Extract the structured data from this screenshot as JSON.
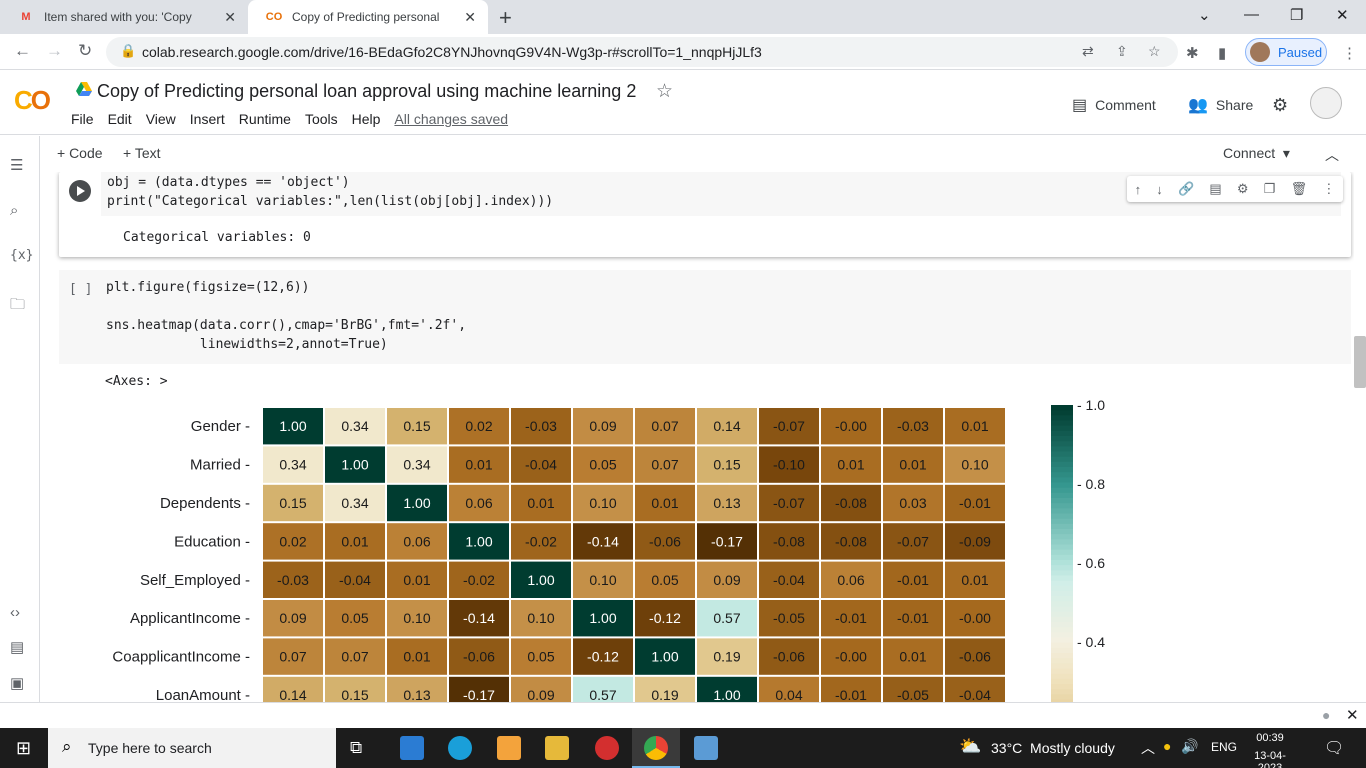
{
  "browser": {
    "tabs": [
      {
        "title": "Item shared with you: 'Copy of Pr",
        "icon": "gmail-icon"
      },
      {
        "title": "Copy of Predicting personal loan",
        "icon": "colab-icon"
      }
    ],
    "url": "colab.research.google.com/drive/16-BEdaGfo2C8YNJhovnqG9V4N-Wg3p-r#scrollTo=1_nnqpHjJLf3",
    "profile_status": "Paused"
  },
  "colab": {
    "logo": "CO",
    "title": "Copy of Predicting personal loan approval using machine learning 2",
    "menu": [
      "File",
      "Edit",
      "View",
      "Insert",
      "Runtime",
      "Tools",
      "Help"
    ],
    "saved_status": "All changes saved",
    "comment_label": "Comment",
    "share_label": "Share",
    "add_code": "+ Code",
    "add_text": "+ Text",
    "connect_label": "Connect"
  },
  "cells": {
    "cell1": {
      "line1": "obj = (data.dtypes == 'object')",
      "line2": "print(\"Categorical variables:\",len(list(obj[obj].index)))",
      "output": "Categorical variables: 0"
    },
    "cell2": {
      "bracket": "[ ]",
      "line1": "plt.figure(figsize=(12,6))",
      "line2": "sns.heatmap(data.corr(),cmap='BrBG',fmt='.2f',",
      "line3": "            linewidths=2,annot=True)",
      "output": "<Axes: >"
    }
  },
  "chart_data": {
    "type": "heatmap",
    "cmap": "BrBG",
    "rows": [
      "Gender",
      "Married",
      "Dependents",
      "Education",
      "Self_Employed",
      "ApplicantIncome",
      "CoapplicantIncome",
      "LoanAmount"
    ],
    "values": [
      [
        "1.00",
        "0.34",
        "0.15",
        "0.02",
        "-0.03",
        "0.09",
        "0.07",
        "0.14",
        "-0.07",
        "-0.00",
        "-0.03",
        "0.01"
      ],
      [
        "0.34",
        "1.00",
        "0.34",
        "0.01",
        "-0.04",
        "0.05",
        "0.07",
        "0.15",
        "-0.10",
        "0.01",
        "0.01",
        "0.10"
      ],
      [
        "0.15",
        "0.34",
        "1.00",
        "0.06",
        "0.01",
        "0.10",
        "0.01",
        "0.13",
        "-0.07",
        "-0.08",
        "0.03",
        "-0.01"
      ],
      [
        "0.02",
        "0.01",
        "0.06",
        "1.00",
        "-0.02",
        "-0.14",
        "-0.06",
        "-0.17",
        "-0.08",
        "-0.08",
        "-0.07",
        "-0.09"
      ],
      [
        "-0.03",
        "-0.04",
        "0.01",
        "-0.02",
        "1.00",
        "0.10",
        "0.05",
        "0.09",
        "-0.04",
        "0.06",
        "-0.01",
        "0.01"
      ],
      [
        "0.09",
        "0.05",
        "0.10",
        "-0.14",
        "0.10",
        "1.00",
        "-0.12",
        "0.57",
        "-0.05",
        "-0.01",
        "-0.01",
        "-0.00"
      ],
      [
        "0.07",
        "0.07",
        "0.01",
        "-0.06",
        "0.05",
        "-0.12",
        "1.00",
        "0.19",
        "-0.06",
        "-0.00",
        "0.01",
        "-0.06"
      ],
      [
        "0.14",
        "0.15",
        "0.13",
        "-0.17",
        "0.09",
        "0.57",
        "0.19",
        "1.00",
        "0.04",
        "-0.01",
        "-0.05",
        "-0.04"
      ]
    ],
    "colorbar_ticks": [
      "1.0",
      "0.8",
      "0.6",
      "0.4"
    ],
    "colorbar_range": [
      0.2,
      1.0
    ]
  },
  "taskbar": {
    "search_placeholder": "Type here to search",
    "weather": "33°C  Mostly cloudy",
    "language": "ENG",
    "time": "00:39",
    "date": "13-04-2023"
  }
}
